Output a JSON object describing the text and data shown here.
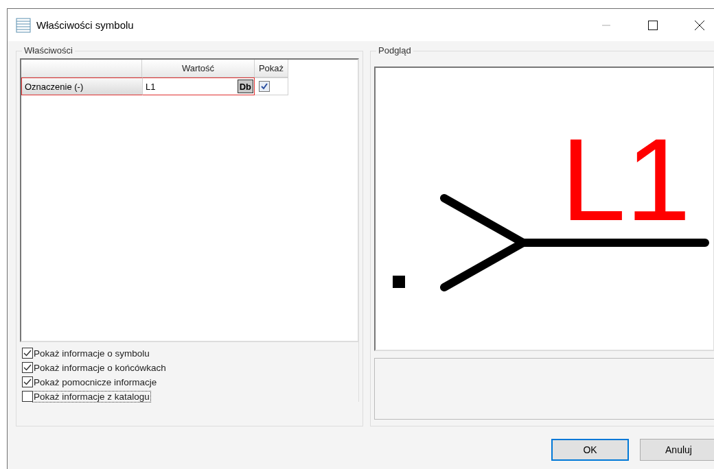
{
  "window": {
    "title": "Właściwości symbolu"
  },
  "properties": {
    "title": "Właściwości",
    "columns": [
      "Wartość",
      "Pokaż"
    ],
    "rows": [
      {
        "name": "Oznaczenie (-)",
        "value": "L1",
        "db_button": "Db",
        "show": true,
        "selected": true
      }
    ]
  },
  "options": [
    {
      "label": "Pokaż informacje o symbolu",
      "checked": true,
      "focused": false
    },
    {
      "label": "Pokaż informacje o końcówkach",
      "checked": true,
      "focused": false
    },
    {
      "label": "Pokaż pomocnicze informacje",
      "checked": true,
      "focused": false
    },
    {
      "label": "Pokaż informacje z katalogu",
      "checked": false,
      "focused": true
    }
  ],
  "preview": {
    "title": "Podgląd",
    "designation": "L1"
  },
  "buttons": [
    {
      "label": "OK",
      "default": true
    },
    {
      "label": "Anuluj",
      "default": false
    }
  ]
}
